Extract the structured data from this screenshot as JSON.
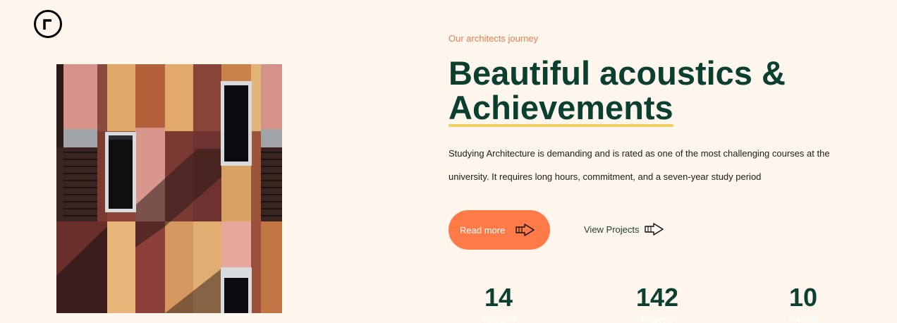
{
  "header": {
    "logo_icon": "logo-ring-icon"
  },
  "hero": {
    "eyebrow": "Our architects journey",
    "title_line1": "Beautiful acoustics &",
    "title_line2": "Achievements",
    "description": "Studying Architecture is demanding and is rated as one of the most challenging courses at the university. It requires long hours, commitment, and a seven-year study period",
    "image_icon": "building-facade-image"
  },
  "actions": {
    "read_more_label": "Read more",
    "read_more_icon": "hand-pointer-arrow-icon",
    "view_projects_label": "View Projects",
    "view_projects_icon": "hand-pointer-arrow-icon"
  },
  "stats": [
    {
      "value": "14",
      "label": "Years of"
    },
    {
      "value": "142",
      "label": "Projects"
    },
    {
      "value": "10",
      "label": "Awards"
    }
  ],
  "colors": {
    "background": "#fef5ec",
    "accent": "#fe7b47",
    "heading": "#0b4030",
    "underline": "#f2cf5e"
  }
}
